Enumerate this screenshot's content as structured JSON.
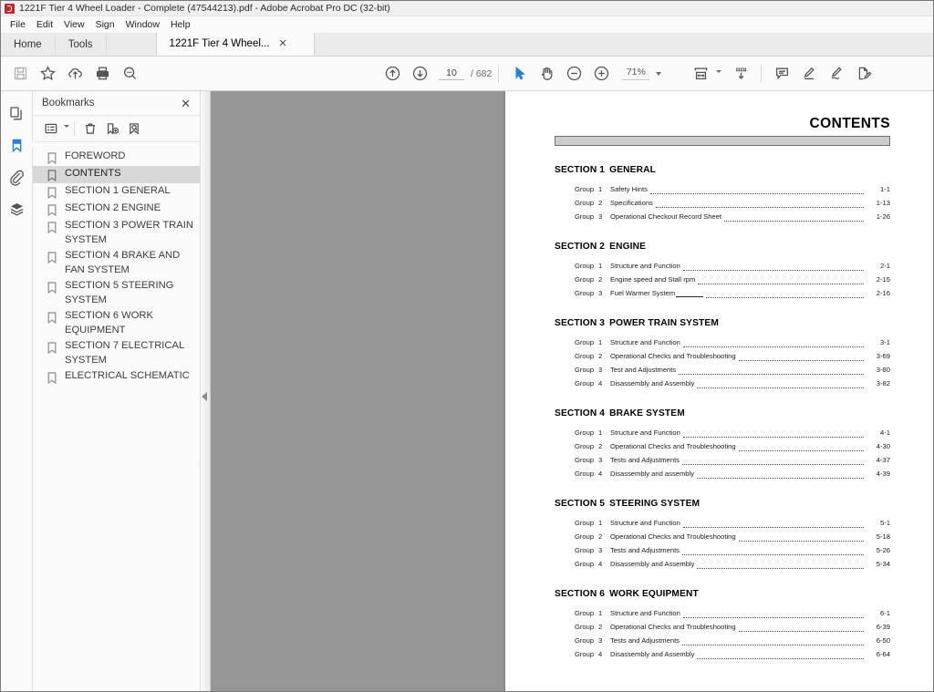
{
  "window": {
    "title": "1221F Tier 4 Wheel Loader - Complete (47544213).pdf - Adobe Acrobat Pro DC (32-bit)",
    "logo_icon": "acrobat-logo-icon"
  },
  "menubar": {
    "items": [
      {
        "label": "File"
      },
      {
        "label": "Edit"
      },
      {
        "label": "View"
      },
      {
        "label": "Sign"
      },
      {
        "label": "Window"
      },
      {
        "label": "Help"
      }
    ]
  },
  "tabs": [
    {
      "label": "Home",
      "type": "static"
    },
    {
      "label": "Tools",
      "type": "static"
    },
    {
      "label": "1221F Tier 4 Wheel...",
      "type": "document",
      "close_label": "✕"
    }
  ],
  "toolbar": {
    "left_buttons": [
      {
        "name": "save-button",
        "icon": "save-floppy-icon",
        "disabled": true
      },
      {
        "name": "add-to-favorites-button",
        "icon": "star-icon",
        "disabled": false
      },
      {
        "name": "upload-to-cloud-button",
        "icon": "cloud-upload-icon",
        "disabled": false
      },
      {
        "name": "print-button",
        "icon": "printer-icon",
        "disabled": false
      },
      {
        "name": "find-button",
        "icon": "search-magnifier-icon",
        "disabled": false
      }
    ],
    "page_nav": {
      "previous_page_icon": "arrow-up-circle-icon",
      "next_page_icon": "arrow-down-circle-icon",
      "current_page": "10",
      "page_placeholder": "10",
      "total_pages": "/ 682"
    },
    "tools": [
      {
        "name": "select-tool",
        "icon": "cursor-arrow-icon",
        "active": true
      },
      {
        "name": "pan-tool",
        "icon": "hand-icon",
        "active": false
      },
      {
        "name": "zoom-out-button",
        "icon": "minus-circle-icon",
        "active": false
      },
      {
        "name": "zoom-in-button",
        "icon": "plus-circle-icon",
        "active": false
      }
    ],
    "zoom": {
      "value": "71%",
      "dropdown_icon": "chevron-down-icon"
    },
    "right_buttons": [
      {
        "name": "fit-page-button",
        "icon": "fit-page-icon",
        "has_dropdown": true
      },
      {
        "name": "scroll-mode-button",
        "icon": "page-scroll-down-icon",
        "has_dropdown": false
      },
      {
        "name": "add-comment-button",
        "icon": "comment-bubble-icon",
        "has_dropdown": false
      },
      {
        "name": "highlight-text-button",
        "icon": "highlighter-pen-icon",
        "has_dropdown": false
      },
      {
        "name": "draw-freeform-button",
        "icon": "pencil-draw-icon",
        "has_dropdown": false
      },
      {
        "name": "fill-and-sign-button",
        "icon": "sign-document-icon",
        "has_dropdown": false
      }
    ]
  },
  "rail": {
    "items": [
      {
        "name": "page-thumbnails-button",
        "icon": "pages-thumbnail-icon",
        "active": false
      },
      {
        "name": "bookmarks-button",
        "icon": "bookmark-icon",
        "active": true
      },
      {
        "name": "attachments-button",
        "icon": "paperclip-icon",
        "active": false
      },
      {
        "name": "layers-button",
        "icon": "layers-stack-icon",
        "active": false
      }
    ]
  },
  "bookmarks_panel": {
    "title": "Bookmarks",
    "close_label": "✕",
    "tools": [
      {
        "name": "bookmark-options-button",
        "icon": "list-options-icon",
        "has_dropdown": true
      },
      {
        "name": "delete-bookmark-button",
        "icon": "trash-can-icon",
        "has_dropdown": false
      },
      {
        "name": "new-bookmark-button",
        "icon": "bookmark-add-icon",
        "has_dropdown": false
      },
      {
        "name": "find-bookmark-button",
        "icon": "bookmark-search-icon",
        "has_dropdown": false
      }
    ],
    "items": [
      {
        "label": "FOREWORD",
        "selected": false
      },
      {
        "label": "CONTENTS",
        "selected": true
      },
      {
        "label": "SECTION 1 GENERAL",
        "selected": false
      },
      {
        "label": "SECTION 2 ENGINE",
        "selected": false
      },
      {
        "label": "SECTION 3 POWER TRAIN SYSTEM",
        "selected": false
      },
      {
        "label": "SECTION 4 BRAKE AND FAN SYSTEM",
        "selected": false
      },
      {
        "label": "SECTION 5 STEERING SYSTEM",
        "selected": false
      },
      {
        "label": "SECTION 6 WORK EQUIPMENT",
        "selected": false
      },
      {
        "label": "SECTION 7 ELECTRICAL SYSTEM",
        "selected": false
      },
      {
        "label": "ELECTRICAL SCHEMATIC",
        "selected": false
      }
    ],
    "collapse_arrow_icon": "collapse-panel-left-icon"
  },
  "document": {
    "heading": "CONTENTS",
    "group_word": "Group",
    "sections": [
      {
        "number": "SECTION 1",
        "name": "GENERAL",
        "entries": [
          {
            "num": "1",
            "title": "Safety Hints",
            "page": "1-1",
            "trailing_dash": false
          },
          {
            "num": "2",
            "title": "Specifications",
            "page": "1-13",
            "trailing_dash": false
          },
          {
            "num": "3",
            "title": "Operational Checkout Record Sheet",
            "page": "1-26",
            "trailing_dash": false
          }
        ]
      },
      {
        "number": "SECTION 2",
        "name": "ENGINE",
        "entries": [
          {
            "num": "1",
            "title": "Structure and Function",
            "page": "2-1",
            "trailing_dash": false
          },
          {
            "num": "2",
            "title": "Engine speed and Stall rpm",
            "page": "2-15",
            "trailing_dash": false
          },
          {
            "num": "3",
            "title": "Fuel Warmer System",
            "page": "2-16",
            "trailing_dash": true
          }
        ]
      },
      {
        "number": "SECTION 3",
        "name": "POWER TRAIN SYSTEM",
        "entries": [
          {
            "num": "1",
            "title": "Structure and Function",
            "page": "3-1",
            "trailing_dash": false
          },
          {
            "num": "2",
            "title": "Operational Checks and Troubleshooting",
            "page": "3-69",
            "trailing_dash": false
          },
          {
            "num": "3",
            "title": "Test and Adjustments",
            "page": "3-80",
            "trailing_dash": false
          },
          {
            "num": "4",
            "title": "Disassembly and Assembly",
            "page": "3-82",
            "trailing_dash": false
          }
        ]
      },
      {
        "number": "SECTION 4",
        "name": "BRAKE SYSTEM",
        "entries": [
          {
            "num": "1",
            "title": "Structure and Function",
            "page": "4-1",
            "trailing_dash": false
          },
          {
            "num": "2",
            "title": "Operational Checks and Troubleshooting",
            "page": "4-30",
            "trailing_dash": false
          },
          {
            "num": "3",
            "title": "Tests and Adjustments",
            "page": "4-37",
            "trailing_dash": false
          },
          {
            "num": "4",
            "title": "Disassembly and assembly",
            "page": "4-39",
            "trailing_dash": false
          }
        ]
      },
      {
        "number": "SECTION 5",
        "name": "STEERING SYSTEM",
        "entries": [
          {
            "num": "1",
            "title": "Structure and Function",
            "page": "5-1",
            "trailing_dash": false
          },
          {
            "num": "2",
            "title": "Operational Checks and Troubleshooting",
            "page": "5-18",
            "trailing_dash": false
          },
          {
            "num": "3",
            "title": "Tests and Adjustments",
            "page": "5-26",
            "trailing_dash": false
          },
          {
            "num": "4",
            "title": "Disassembly and Assembly",
            "page": "5-34",
            "trailing_dash": false
          }
        ]
      },
      {
        "number": "SECTION 6",
        "name": "WORK EQUIPMENT",
        "entries": [
          {
            "num": "1",
            "title": "Structure and Function",
            "page": "6-1",
            "trailing_dash": false
          },
          {
            "num": "2",
            "title": "Operational Checks and Troubleshooting",
            "page": "6-39",
            "trailing_dash": false
          },
          {
            "num": "3",
            "title": "Tests and Adjustments",
            "page": "6-50",
            "trailing_dash": false
          },
          {
            "num": "4",
            "title": "Disassembly and Assembly",
            "page": "6-64",
            "trailing_dash": false
          }
        ]
      }
    ]
  },
  "colors": {
    "accent_blue": "#2a7fd4",
    "viewer_background": "#969696",
    "selection_grey": "#d8d8d8",
    "acrobat_red": "#cc2229"
  }
}
